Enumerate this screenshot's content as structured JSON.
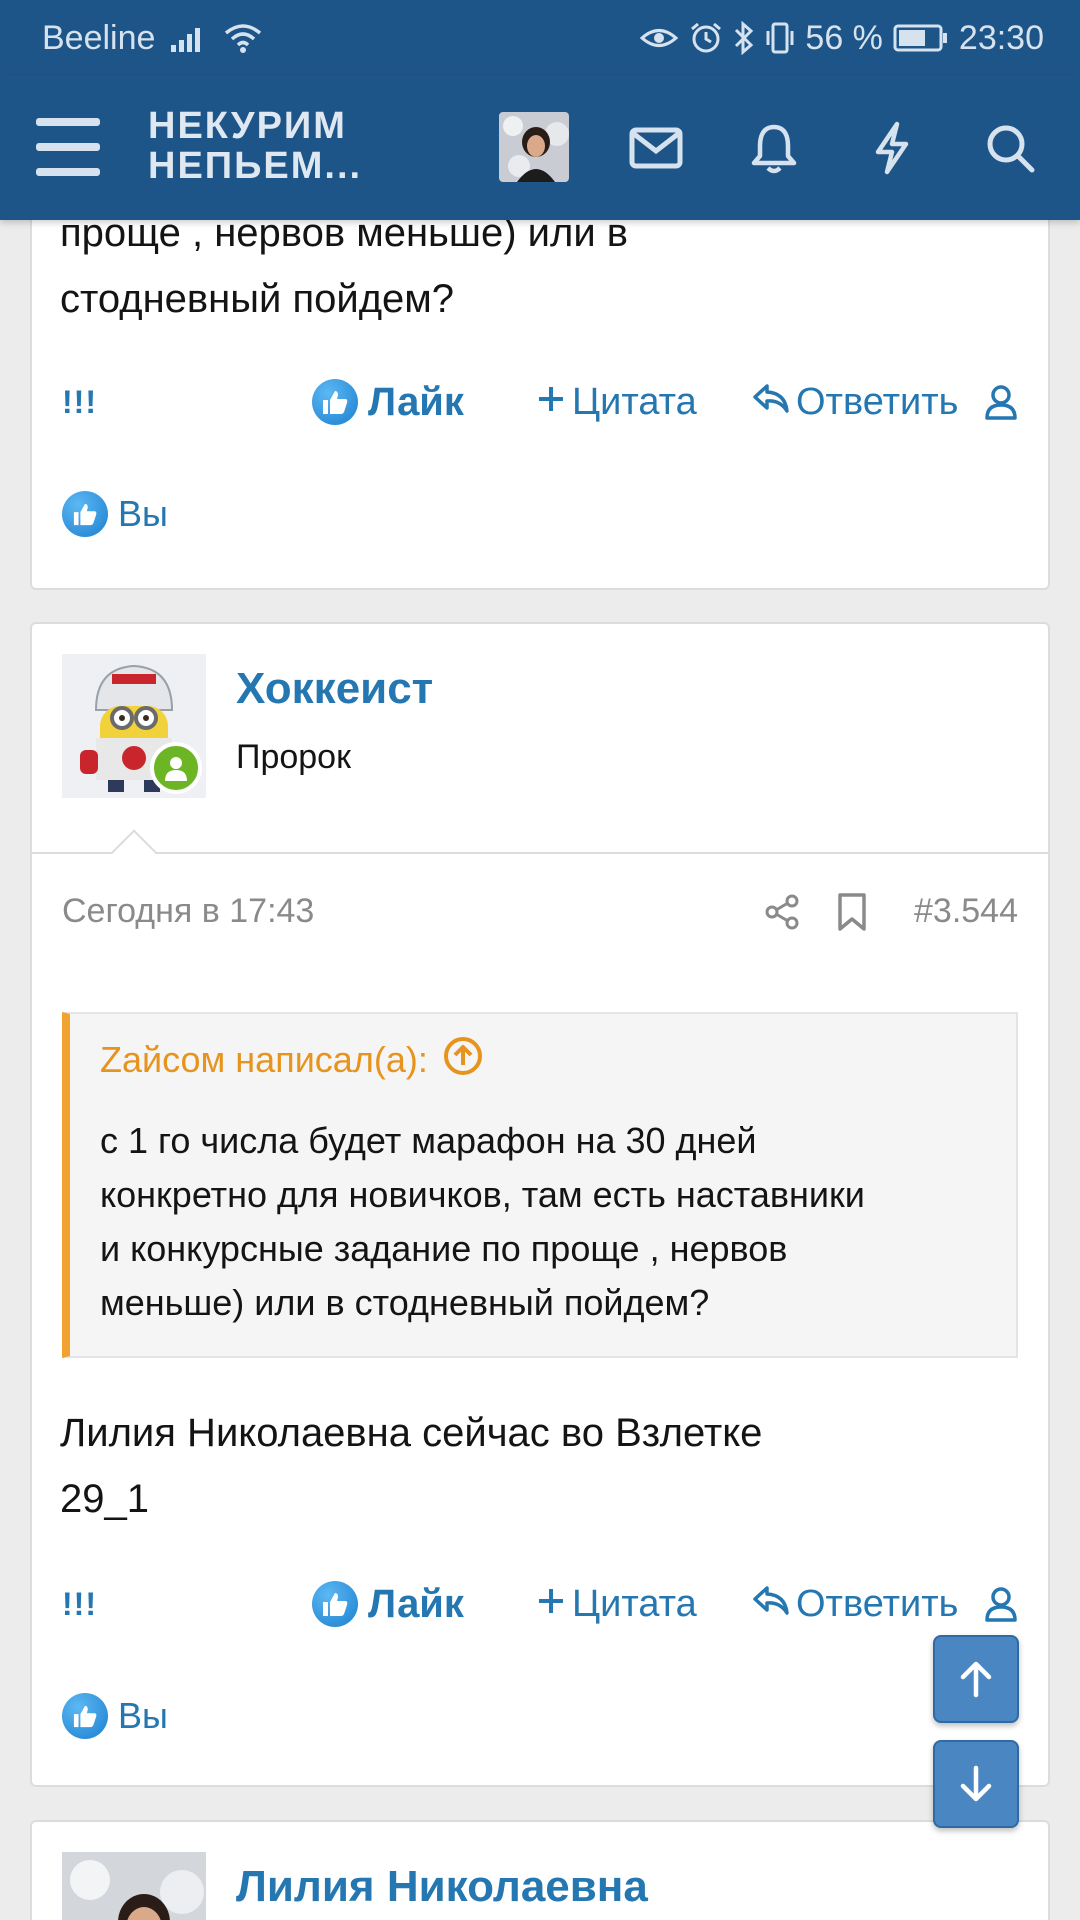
{
  "statusbar": {
    "carrier": "Beeline",
    "battery_pct": "56 %",
    "time": "23:30"
  },
  "header": {
    "site_title_line1": "НЕКУРИМ",
    "site_title_line2": "НЕПЬЕМ..."
  },
  "post_prev": {
    "text_line1": "проще , нервов меньше) или в",
    "text_line2": "стодневный пойдем?",
    "actions": {
      "report": "!!!",
      "like": "Лайк",
      "quote": "Цитата",
      "reply": "Ответить"
    },
    "likes_label": "Вы"
  },
  "post": {
    "username": "Хоккеист",
    "user_title": "Пророк",
    "date": "Сегодня в 17:43",
    "post_number": "#3.544",
    "quote": {
      "author_line": "Zайсом написал(а):",
      "lines": [
        "с 1 го числа будет марафон на 30 дней",
        "конкретно для новичков, там есть наставники",
        "и конкурсные задание по проще , нервов",
        "меньше) или в стодневный пойдем?"
      ]
    },
    "text_line1": "Лилия Николаевна сейчас во Взлетке",
    "text_line2": "29_1",
    "actions": {
      "report": "!!!",
      "like": "Лайк",
      "quote": "Цитата",
      "reply": "Ответить"
    },
    "likes_label": "Вы"
  },
  "post_next": {
    "username": "Лилия Николаевна"
  },
  "colors": {
    "header_bg": "#1e5589",
    "link": "#2577b1",
    "quote_accent": "#f1a230",
    "online": "#6cb524"
  },
  "icons": [
    "menu-icon",
    "mail-icon",
    "bell-icon",
    "bolt-icon",
    "search-icon",
    "like-icon",
    "plus-icon",
    "reply-icon",
    "user-icon",
    "share-icon",
    "bookmark-icon",
    "arrow-up-icon",
    "arrow-down-icon"
  ]
}
